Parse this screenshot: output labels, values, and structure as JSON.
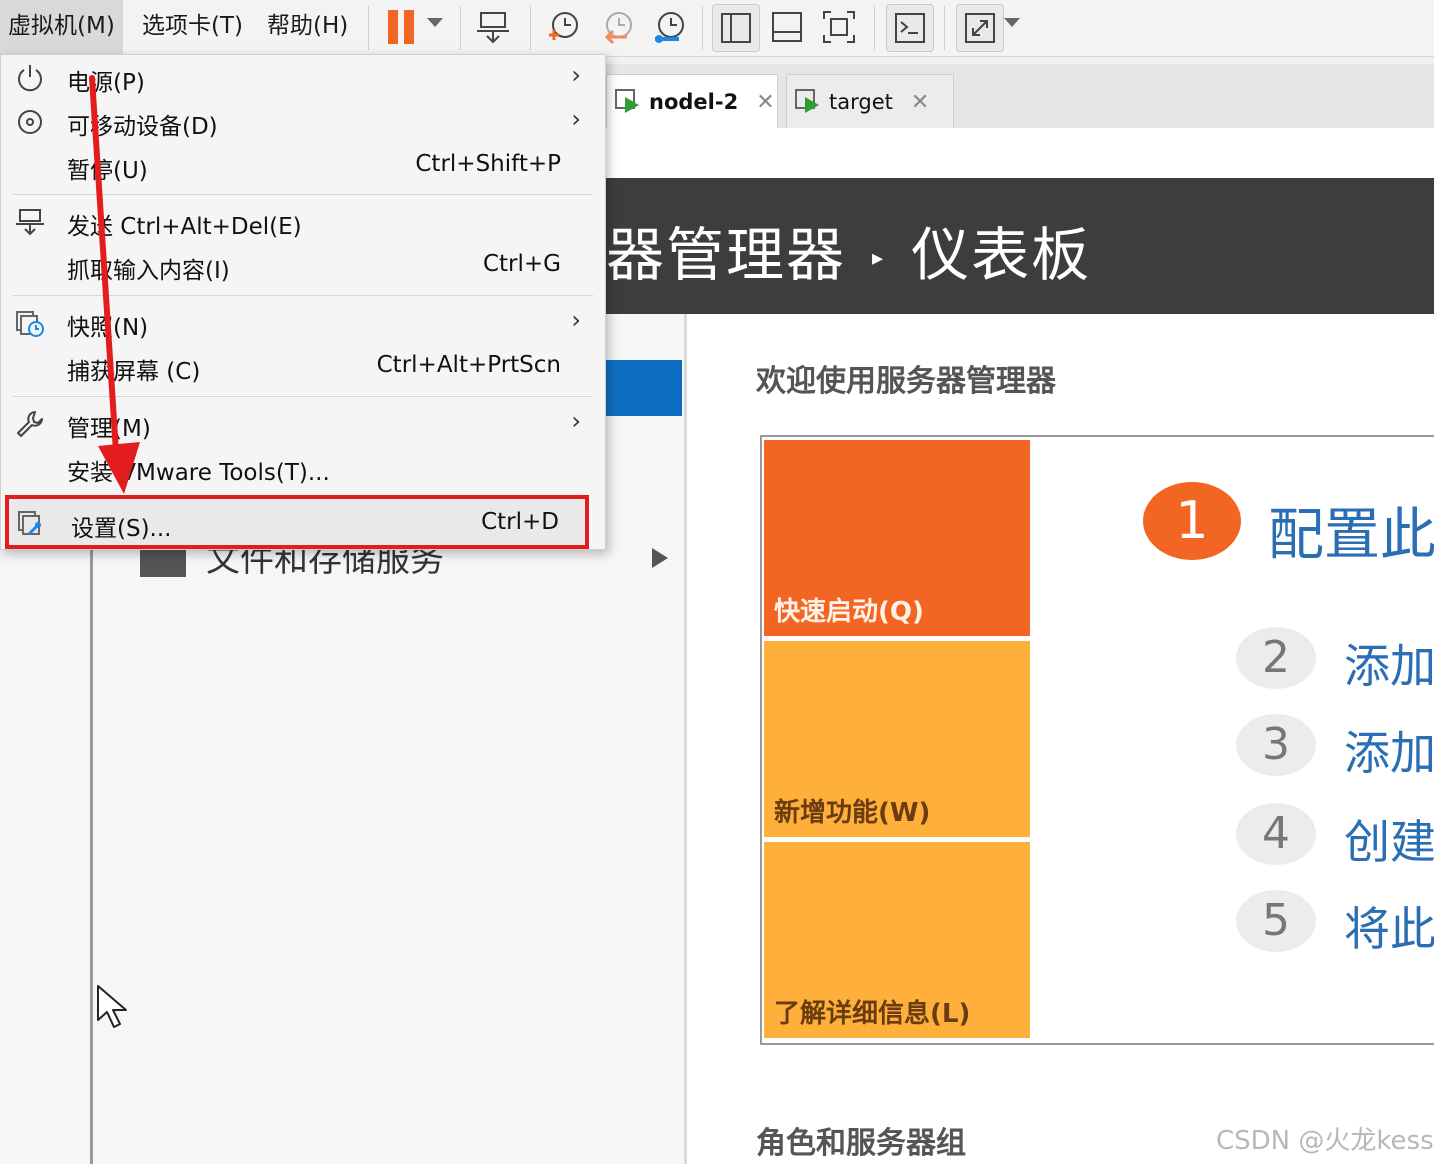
{
  "menubar": {
    "items": [
      {
        "label": "虚拟机(M)"
      },
      {
        "label": "选项卡(T)"
      },
      {
        "label": "帮助(H)"
      }
    ]
  },
  "tabs": [
    {
      "label": "nodel-2",
      "active": true
    },
    {
      "label": "target",
      "active": false
    }
  ],
  "vm_menu": {
    "items": [
      {
        "label": "电源(P)",
        "shortcut": "",
        "submenu": true,
        "icon": "power-icon"
      },
      {
        "label": "可移动设备(D)",
        "shortcut": "",
        "submenu": true,
        "icon": "disc-icon"
      },
      {
        "label": "暂停(U)",
        "shortcut": "Ctrl+Shift+P",
        "submenu": false,
        "icon": ""
      },
      {
        "label": "发送 Ctrl+Alt+Del(E)",
        "shortcut": "",
        "submenu": false,
        "icon": "send-keys-icon"
      },
      {
        "label": "抓取输入内容(I)",
        "shortcut": "Ctrl+G",
        "submenu": false,
        "icon": ""
      },
      {
        "label": "快照(N)",
        "shortcut": "",
        "submenu": true,
        "icon": "snapshot-icon"
      },
      {
        "label": "捕获屏幕 (C)",
        "shortcut": "Ctrl+Alt+PrtScn",
        "submenu": false,
        "icon": ""
      },
      {
        "label": "管理(M)",
        "shortcut": "",
        "submenu": true,
        "icon": "wrench-icon"
      },
      {
        "label": "安装 VMware Tools(T)...",
        "shortcut": "",
        "submenu": false,
        "icon": ""
      },
      {
        "label": "设置(S)...",
        "shortcut": "Ctrl+D",
        "submenu": false,
        "icon": "settings-icon",
        "highlighted": true
      }
    ]
  },
  "guest": {
    "header_part1": "器管理器",
    "header_part2": "仪表板",
    "sidebar_item": "文件和存储服务",
    "welcome": "欢迎使用服务器管理器",
    "tiles": [
      "快速启动(Q)",
      "新增功能(W)",
      "了解详细信息(L)"
    ],
    "steps": [
      {
        "num": "1",
        "text": "配置此"
      },
      {
        "num": "2",
        "text": "添加"
      },
      {
        "num": "3",
        "text": "添加"
      },
      {
        "num": "4",
        "text": "创建"
      },
      {
        "num": "5",
        "text": "将此"
      }
    ],
    "roles_heading": "角色和服务器组"
  },
  "watermark": "CSDN @火龙kess",
  "colors": {
    "accent_orange": "#f26522",
    "tile_yellow": "#ffb03b",
    "highlight_red": "#e31d1d",
    "link_blue": "#2a6eb4"
  }
}
